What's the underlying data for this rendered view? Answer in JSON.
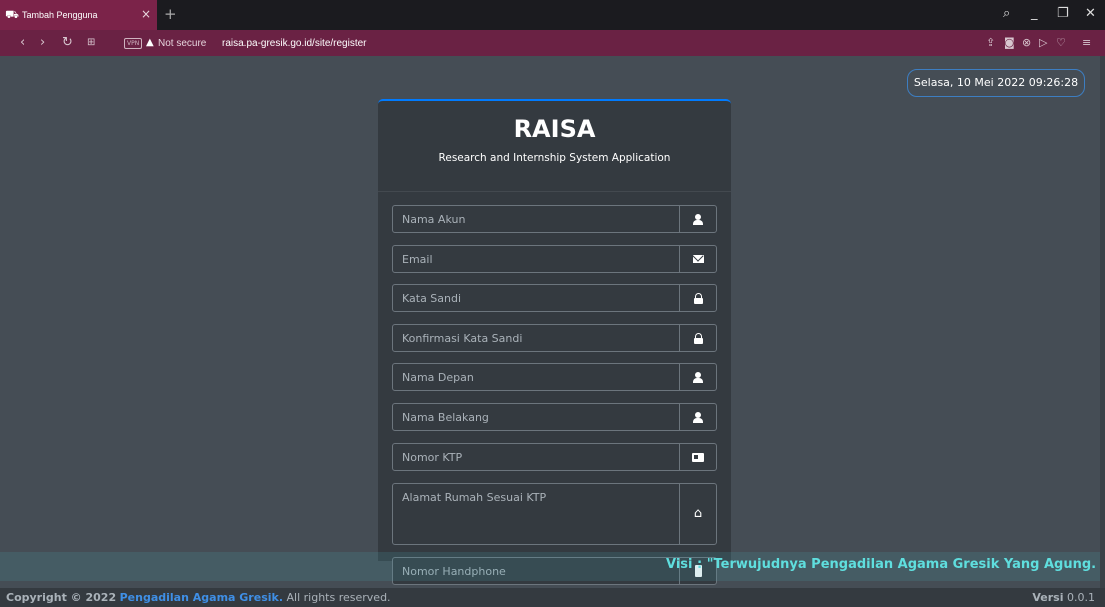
{
  "browser": {
    "tab_title": "Tambah Pengguna",
    "new_tab": "+",
    "close": "×",
    "not_secure": "Not secure",
    "url": "raisa.pa-gresik.go.id/site/register",
    "vpn": "VPN"
  },
  "clock": "Selasa, 10 Mei 2022 09:26:28",
  "header": {
    "brand": "RAISA",
    "subtitle": "Research and Internship System Application"
  },
  "form": {
    "nama_akun": "Nama Akun",
    "email": "Email",
    "kata_sandi": "Kata Sandi",
    "konfirmasi_kata_sandi": "Konfirmasi Kata Sandi",
    "nama_depan": "Nama Depan",
    "nama_belakang": "Nama Belakang",
    "nomor_ktp": "Nomor KTP",
    "alamat": "Alamat Rumah Sesuai KTP",
    "nomor_handphone": "Nomor Handphone"
  },
  "icons": {
    "user": "user-icon",
    "mail": "envelope-icon",
    "lock": "lock-icon",
    "id": "id-card-icon",
    "home": "home-icon",
    "phone": "phone-icon"
  },
  "marquee": "Visi : \"Terwujudnya Pengadilan Agama Gresik Yang Agung. Misi",
  "footer": {
    "copyright": "Copyright © 2022",
    "org": "Pengadilan Agama Gresik.",
    "rights": "All rights reserved.",
    "version_label": "Versi",
    "version": "0.0.1"
  },
  "colors": {
    "accent": "#007bff",
    "tab": "#7b2349",
    "marquee": "#5fdede"
  }
}
